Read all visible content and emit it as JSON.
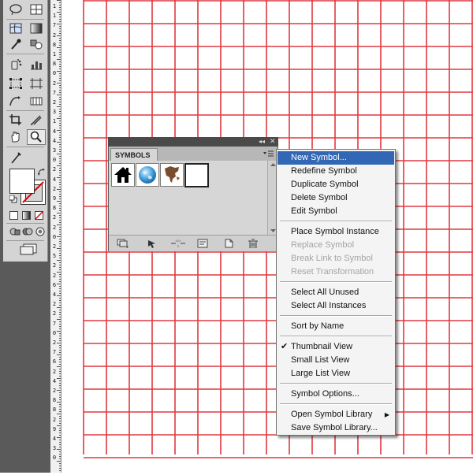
{
  "ruler": {
    "digits": [
      "1",
      "1",
      "7",
      "2",
      "8",
      "1",
      "8",
      "0",
      "2",
      "7",
      "2",
      "3",
      "1",
      "4",
      "4",
      "3",
      "0",
      "2",
      "4",
      "2",
      "9",
      "8",
      "2",
      "2",
      "0",
      "2",
      "5",
      "2",
      "2",
      "6",
      "4",
      "2",
      "2",
      "7",
      "0",
      "2",
      "7",
      "6",
      "2",
      "4",
      "2",
      "8",
      "8",
      "2",
      "9",
      "4",
      "3",
      "0"
    ]
  },
  "grid": {
    "line_color": "#e0393f"
  },
  "tools": {
    "icons": [
      "lasso-select-icon",
      "graph-icon",
      "mesh-icon",
      "gradient-icon",
      "eyedropper-icon",
      "blend-icon",
      "symbol-sprayer-icon",
      "column-graph-icon",
      "free-transform-icon",
      "artboard-icon",
      "warp-icon",
      "slice-icon",
      "crop-area-icon",
      "eraser-icon",
      "hand-icon",
      "zoom-icon"
    ]
  },
  "symbols_panel": {
    "tab_label": "SYMBOLS",
    "collapse_glyph": "◂◂",
    "close_glyph": "✕",
    "symbols": [
      "home-symbol",
      "globe-symbol",
      "map-symbol",
      "blank-symbol"
    ],
    "bottom_icons": [
      "symbol-libraries-menu-icon",
      "place-symbol-instance-icon",
      "break-link-icon",
      "symbol-options-icon",
      "new-symbol-icon",
      "delete-symbol-icon"
    ]
  },
  "menu": {
    "new_symbol": "New Symbol...",
    "redefine_symbol": "Redefine Symbol",
    "duplicate_symbol": "Duplicate Symbol",
    "delete_symbol": "Delete Symbol",
    "edit_symbol": "Edit Symbol",
    "place_symbol_instance": "Place Symbol Instance",
    "replace_symbol": "Replace Symbol",
    "break_link": "Break Link to Symbol",
    "reset_transformation": "Reset Transformation",
    "select_all_unused": "Select All Unused",
    "select_all_instances": "Select All Instances",
    "sort_by_name": "Sort by Name",
    "thumbnail_view": "Thumbnail View",
    "small_list_view": "Small List View",
    "large_list_view": "Large List View",
    "symbol_options": "Symbol Options...",
    "open_symbol_library": "Open Symbol Library",
    "save_symbol_library": "Save Symbol Library...",
    "check_glyph": "✔",
    "submenu_glyph": "▶",
    "highlight_color": "#3167b4"
  }
}
